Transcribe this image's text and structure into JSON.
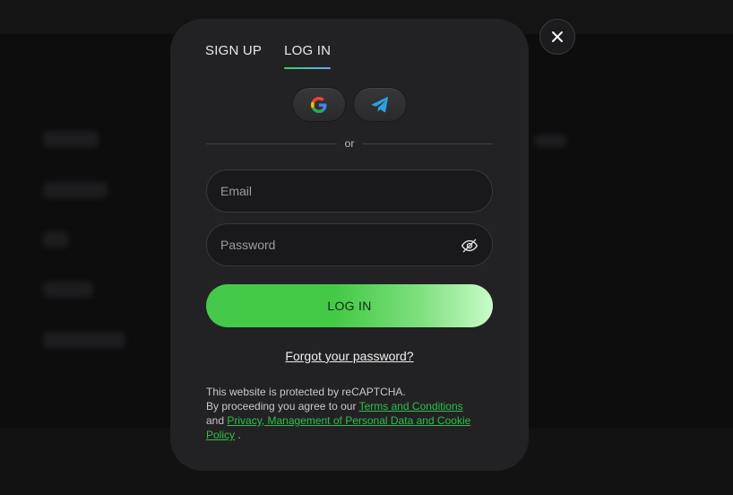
{
  "tabs": [
    {
      "label": "SIGN UP",
      "active": false
    },
    {
      "label": "LOG IN",
      "active": true
    }
  ],
  "social": [
    {
      "icon": "google-icon"
    },
    {
      "icon": "telegram-icon"
    }
  ],
  "divider_text": "or",
  "email": {
    "placeholder": "Email",
    "value": ""
  },
  "password": {
    "placeholder": "Password",
    "value": "",
    "toggle_icon": "eye-off-icon"
  },
  "login_button": "LOG IN",
  "forgot_link": "Forgot your password?",
  "legal": {
    "line1": "This website is protected by reCAPTCHA.",
    "line2_prefix": "By proceeding you agree to our ",
    "terms_link": "Terms and Conditions",
    "line3_prefix": "and ",
    "privacy_link": "Privacy, Management of Personal Data and Cookie Policy",
    "suffix": " ."
  },
  "colors": {
    "accent_green": "#45c94a",
    "link_green": "#2fbf4b",
    "modal_bg": "#222224",
    "tab_underline_end": "#6aa7ff"
  }
}
